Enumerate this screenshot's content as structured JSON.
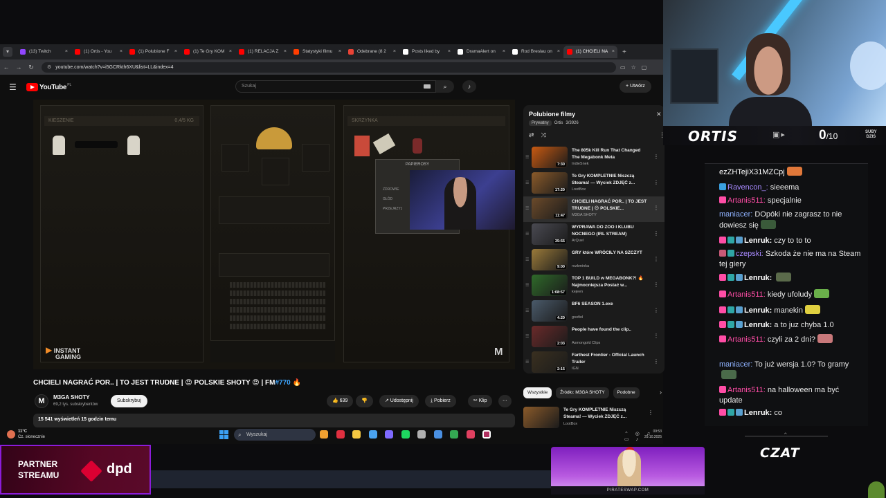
{
  "browser": {
    "tabs": [
      {
        "label": "(13) Twitch",
        "color": "#9146ff",
        "active": false
      },
      {
        "label": "(1) Ortis - You",
        "color": "#ff0000",
        "active": false
      },
      {
        "label": "(1) Polubione F",
        "color": "#ff0000",
        "active": false
      },
      {
        "label": "(1) Te Gry KOM",
        "color": "#ff0000",
        "active": false
      },
      {
        "label": "(1) RELACJA Z",
        "color": "#ff0000",
        "active": false
      },
      {
        "label": "Statystyki filmu",
        "color": "#ff3d00",
        "active": false
      },
      {
        "label": "Odebrane (8 2",
        "color": "#ea4335",
        "active": false
      },
      {
        "label": "Posts liked by",
        "color": "#ffffff",
        "active": false
      },
      {
        "label": "DramaAlert on",
        "color": "#ffffff",
        "active": false
      },
      {
        "label": "Rod Breslau on",
        "color": "#ffffff",
        "active": false
      },
      {
        "label": "(1) CHCIELI NA",
        "color": "#ff0000",
        "active": true
      }
    ],
    "new_tab": "+",
    "url": "youtube.com/watch?v=i5GCRkth6XU&list=LL&index=4"
  },
  "youtube": {
    "logo_text": "YouTube",
    "logo_sup": "PL",
    "search_placeholder": "Szukaj",
    "create_label": "+ Utwórz",
    "video_title_main": "CHCIELI NAGRAĆ POR.. | TO JEST TRUDNE | 😍 POLSKIE SHOTY 😍 | FM",
    "video_title_hash": "#770",
    "video_title_tail": " 🔥",
    "channel": {
      "avatar_letter": "M",
      "name": "M3GA SHOTY",
      "subs": "69,2 tys. subskrybentów",
      "subscribe_label": "Subskrybuj"
    },
    "actions": {
      "likes": "👍 639",
      "dislike": "👎",
      "share": "↗ Udostępnij",
      "download": "⤓ Pobierz",
      "clip": "✂ Klip",
      "more": "⋯"
    },
    "views_line": "15 541 wyświetleń  15 godzin temu",
    "game": {
      "panel_left_label": "KIESZENIE",
      "panel_left_weight": "0,4/5 KG",
      "panel_right_label": "SKRZYNKA",
      "tooltip_title": "PAPIEROSY",
      "tooltip_opts": [
        "ZDROWIE",
        "GŁÓD",
        "PRZEJRZYJ"
      ],
      "ig_line1": "INSTANT",
      "ig_line2": "GAMING",
      "mark": "M"
    }
  },
  "playlist": {
    "title": "Polubione filmy",
    "privacy": "Prywatny",
    "owner": "Ortis",
    "position": "3/3926",
    "items": [
      {
        "title": "The 805k Kill Run That Changed The Megabonk Meta",
        "channel": "IndieSnek",
        "duration": "7:30",
        "thumb": "#c85a12",
        "active": false
      },
      {
        "title": "Te Gry KOMPLETNIE Niszczą Steama! — Wyciek ZDJĘĆ z...",
        "channel": "LootBox",
        "duration": "17:20",
        "thumb": "#8a5a2a",
        "active": false
      },
      {
        "title": "CHCIELI NAGRAĆ POR.. | TO JEST TRUDNE | 😍 POLSKIE...",
        "channel": "M3GA SHOTY",
        "duration": "11:47",
        "thumb": "#6b4a2a",
        "active": true
      },
      {
        "title": "WYPRAWA DO ZOO I KLUBU NOCNEGO (IRL STREAM)",
        "channel": "ArQuel",
        "duration": "35:55",
        "thumb": "#4a4a52",
        "active": false
      },
      {
        "title": "GRY które WRÓCIŁY NA SZCZYT",
        "channel": "rozkminka",
        "duration": "9:00",
        "thumb": "#9a7a3a",
        "active": false
      },
      {
        "title": "TOP 1 BUILD w MEGABONK?! 🔥 Najmocniejsza Postać w...",
        "channel": "kejeen",
        "duration": "1:08:57",
        "thumb": "#2f6a2a",
        "active": false
      },
      {
        "title": "BF6 SEASON 1.exe",
        "channel": "goofiol",
        "duration": "4:20",
        "thumb": "#4a5a6a",
        "active": false
      },
      {
        "title": "People have found the clip..",
        "channel": "Asmongold Clips",
        "duration": "2:03",
        "thumb": "#6a2a2a",
        "active": false
      },
      {
        "title": "Farthest Frontier - Official Launch Trailer",
        "channel": "IGN",
        "duration": "2:15",
        "thumb": "#3a3020",
        "active": false
      }
    ],
    "chips": [
      {
        "label": "Wszystkie",
        "on": true
      },
      {
        "label": "Źródło: M3GA SHOTY",
        "on": false
      },
      {
        "label": "Podobne",
        "on": false
      }
    ],
    "recommended": {
      "title": "Te Gry KOMPLETNIE Niszczą Steama! — Wyciek ZDJĘĆ z...",
      "channel": "LootBox",
      "thumb": "#8a5a2a"
    }
  },
  "taskbar": {
    "temp": "11°C",
    "weather": "Cz. słonecznie",
    "search_placeholder": "Wyszukaj",
    "time": "09:53",
    "date": "29.10.2025",
    "apps": [
      "#f0a030",
      "#e03040",
      "#f5c842",
      "#4aa3f0",
      "#7f6aff",
      "#1ed760",
      "#b0b0b0",
      "#4a90e2",
      "#34a853",
      "#e04060",
      "#ffffff"
    ]
  },
  "stream": {
    "logo": "ORTIS",
    "sub_count": "0",
    "sub_goal": "/10",
    "sub_label_1": "SUBY",
    "sub_label_2": "DZIŚ",
    "chat_label": "CZAT",
    "partner_line1": "PARTNER",
    "partner_line2": "STREAMU",
    "partner_brand": "dpd",
    "ad_url": "PIRATESWAP.COM"
  },
  "chat": {
    "messages": [
      {
        "user": "",
        "text": "ezZHTejiX31MZCpj",
        "user_class": "u-white",
        "badges": [],
        "emote": "#e0783a"
      },
      {
        "user": "Ravencon_:",
        "text": "sieeema",
        "user_class": "u-violet",
        "badges": [
          "#3aa0e0"
        ],
        "emote": ""
      },
      {
        "user": "Artanis511:",
        "text": "specjalnie",
        "user_class": "u-pink",
        "badges": [
          "#ff4da6"
        ],
        "emote": ""
      },
      {
        "user": "maniacer:",
        "text": "DOpóki nie zagrasz to nie dowiesz się",
        "user_class": "u-blue",
        "badges": [],
        "emote": "#3a5a3a"
      },
      {
        "user": "Lenruk:",
        "text": "czy to to to",
        "user_class": "u-white",
        "badges": [
          "#ff4da6",
          "#2fa6a6",
          "#5aa0d0"
        ],
        "emote": ""
      },
      {
        "user": "czepski:",
        "text": "Szkoda że nie ma na Steam tej giery",
        "user_class": "u-violet",
        "badges": [
          "#c85a78",
          "#2fa6a6"
        ],
        "emote": ""
      },
      {
        "user": "Lenruk:",
        "text": "",
        "user_class": "u-white",
        "badges": [
          "#ff4da6",
          "#2fa6a6",
          "#5aa0d0"
        ],
        "emote": "#5a6a4a"
      },
      {
        "user": "Artanis511:",
        "text": "kiedy ufoludy",
        "user_class": "u-pink",
        "badges": [
          "#ff4da6"
        ],
        "emote": "#6ab04a"
      },
      {
        "user": "Lenruk:",
        "text": "manekin",
        "user_class": "u-white",
        "badges": [
          "#ff4da6",
          "#2fa6a6",
          "#5aa0d0"
        ],
        "emote": "#e0d040"
      },
      {
        "user": "Lenruk:",
        "text": "a to juz chyba 1.0",
        "user_class": "u-white",
        "badges": [
          "#ff4da6",
          "#2fa6a6",
          "#5aa0d0"
        ],
        "emote": ""
      },
      {
        "user": "Artanis511:",
        "text": "czyli za 2 dni?",
        "user_class": "u-pink",
        "badges": [
          "#ff4da6"
        ],
        "emote": "#c8787a"
      },
      {
        "user": "maniacer:",
        "text": "To już wersja 1.0? To gramy",
        "user_class": "u-blue",
        "badges": [],
        "emote": "#4a6a4a"
      },
      {
        "user": "Artanis511:",
        "text": "na halloween ma być update",
        "user_class": "u-pink",
        "badges": [
          "#ff4da6"
        ],
        "emote": ""
      },
      {
        "user": "Lenruk:",
        "text": "co",
        "user_class": "u-white",
        "badges": [
          "#ff4da6",
          "#2fa6a6",
          "#5aa0d0"
        ],
        "emote": ""
      }
    ]
  }
}
